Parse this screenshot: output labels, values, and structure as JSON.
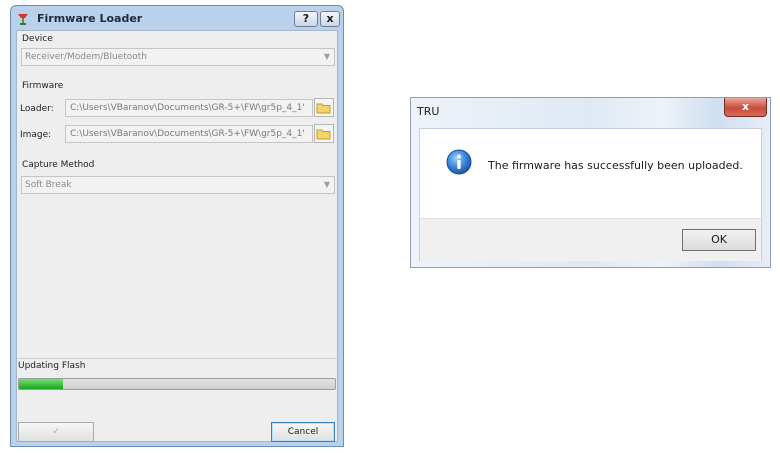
{
  "firmware_loader": {
    "title": "Firmware Loader",
    "help_label": "?",
    "close_label": "x",
    "device": {
      "label": "Device",
      "selected": "Receiver/Modem/Bluetooth"
    },
    "firmware": {
      "group_label": "Firmware",
      "loader_label": "Loader:",
      "loader_value": "C:\\Users\\VBaranov\\Documents\\GR-5+\\FW\\gr5p_4_1'",
      "image_label": "Image:",
      "image_value": "C:\\Users\\VBaranov\\Documents\\GR-5+\\FW\\gr5p_4_1'"
    },
    "capture": {
      "label": "Capture Method",
      "selected": "Soft Break"
    },
    "status": {
      "label": "Updating Flash",
      "progress_fraction": 0.14
    },
    "ok_glyph": "✓",
    "cancel_label": "Cancel"
  },
  "tru_dialog": {
    "title": "TRU",
    "close_label": "x",
    "message": "The firmware has successfully been uploaded.",
    "ok_label": "OK",
    "icon": "info-icon"
  },
  "colors": {
    "progress_fill": "#2fb82f",
    "window_frame": "#b9d1ea",
    "info_icon": "#2f7fd6"
  }
}
